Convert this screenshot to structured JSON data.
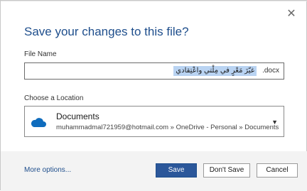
{
  "dialog": {
    "title": "Save your changes to this file?",
    "close_icon": "close-icon"
  },
  "file_name": {
    "label": "File Name",
    "value": "غيّرَ مَعْرٍ في مِلْتي واعْتِقادي",
    "extension": ".docx"
  },
  "location": {
    "label": "Choose a Location",
    "icon": "cloud-icon",
    "name": "Documents",
    "path": "muhammadmal721959@hotmail.com » OneDrive - Personal » Documents"
  },
  "footer": {
    "more_options": "More options...",
    "save": "Save",
    "dont_save": "Don't Save",
    "cancel": "Cancel"
  },
  "colors": {
    "title": "#1e4e8c",
    "primary_button": "#2b579a",
    "selection": "#b9d3f2",
    "footer_bg": "#f3f3f3"
  }
}
